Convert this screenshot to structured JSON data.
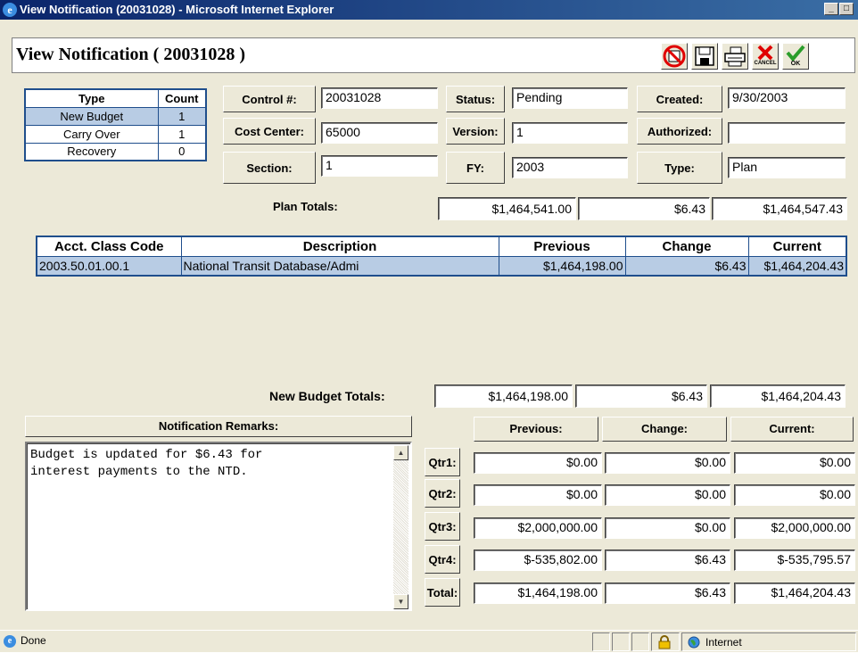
{
  "window": {
    "title": "View Notification (20031028) - Microsoft Internet Explorer",
    "min": "_",
    "max": "□",
    "close": "x"
  },
  "page": {
    "title": "View Notification ( 20031028 )"
  },
  "toolbar": {
    "cancel_label": "CANCEL",
    "ok_label": "OK"
  },
  "type_table": {
    "headers": [
      "Type",
      "Count"
    ],
    "rows": [
      {
        "type": "New Budget",
        "count": "1"
      },
      {
        "type": "Carry Over",
        "count": "1"
      },
      {
        "type": "Recovery",
        "count": "0"
      }
    ]
  },
  "fields": {
    "control_label": "Control #:",
    "control_value": "20031028",
    "status_label": "Status:",
    "status_value": "Pending",
    "created_label": "Created:",
    "created_value": "9/30/2003",
    "cost_center_label": "Cost Center:",
    "cost_center_value": "65000",
    "version_label": "Version:",
    "version_value": "1",
    "authorized_label": "Authorized:",
    "authorized_value": "",
    "section_label": "Section:",
    "section_value": "1",
    "fy_label": "FY:",
    "fy_value": "2003",
    "type_label": "Type:",
    "type_value": "Plan"
  },
  "plan_totals": {
    "label": "Plan Totals:",
    "previous": "$1,464,541.00",
    "change": "$6.43",
    "current": "$1,464,547.43"
  },
  "acct_table": {
    "headers": [
      "Acct. Class Code",
      "Description",
      "Previous",
      "Change",
      "Current"
    ],
    "rows": [
      {
        "code": "2003.50.01.00.1",
        "description": "National Transit Database/Admi",
        "previous": "$1,464,198.00",
        "change": "$6.43",
        "current": "$1,464,204.43"
      }
    ]
  },
  "new_budget_totals": {
    "label": "New Budget Totals:",
    "previous": "$1,464,198.00",
    "change": "$6.43",
    "current": "$1,464,204.43"
  },
  "remarks": {
    "header": "Notification Remarks:",
    "text": "Budget is updated for $6.43 for\ninterest payments to the NTD."
  },
  "quarters": {
    "headers": [
      "Previous:",
      "Change:",
      "Current:"
    ],
    "rows": [
      {
        "label": "Qtr1:",
        "previous": "$0.00",
        "change": "$0.00",
        "current": "$0.00"
      },
      {
        "label": "Qtr2:",
        "previous": "$0.00",
        "change": "$0.00",
        "current": "$0.00"
      },
      {
        "label": "Qtr3:",
        "previous": "$2,000,000.00",
        "change": "$0.00",
        "current": "$2,000,000.00"
      },
      {
        "label": "Qtr4:",
        "previous": "$-535,802.00",
        "change": "$6.43",
        "current": "$-535,795.57"
      },
      {
        "label": "Total:",
        "previous": "$1,464,198.00",
        "change": "$6.43",
        "current": "$1,464,204.43"
      }
    ]
  },
  "statusbar": {
    "status": "Done",
    "zone": "Internet"
  },
  "icons": [
    "ie-icon",
    "no-print-icon",
    "save-icon",
    "print-icon",
    "cancel-icon",
    "ok-check-icon",
    "lock-icon",
    "globe-icon",
    "scroll-up-icon",
    "scroll-down-icon"
  ]
}
